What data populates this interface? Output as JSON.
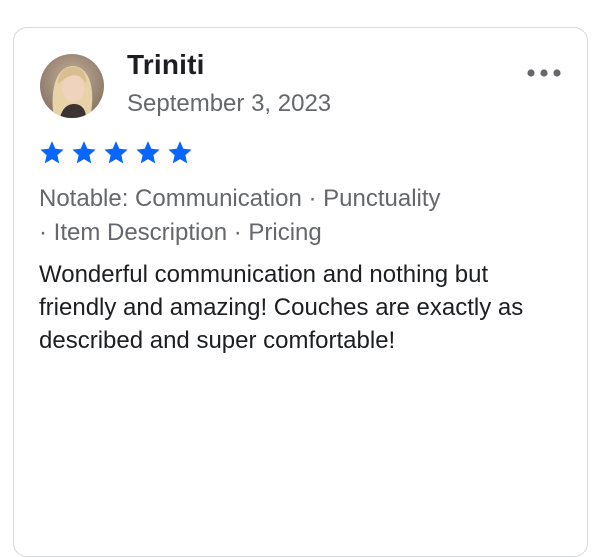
{
  "review": {
    "reviewer_name": "Triniti",
    "date": "September 3, 2023",
    "rating": 5,
    "rating_max": 5,
    "tags_line1": "Notable: Communication · Punctuality",
    "tags_line2": "· Item Description · Pricing",
    "text": "Wonderful communication and nothing but friendly and amazing! Couches are exactly as described and super comfortable!"
  },
  "colors": {
    "star": "#0866ff",
    "name": "#1c1e21",
    "secondary_text": "#65676b",
    "border": "#d6d9dd"
  },
  "icons": {
    "avatar": "profile-photo",
    "more": "more-horizontal-icon",
    "star": "star-icon"
  }
}
